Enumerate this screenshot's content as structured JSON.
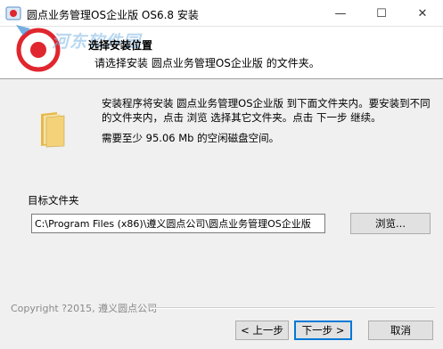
{
  "window": {
    "title": "圆点业务管理OS企业版 OS6.8 安装",
    "minimize_glyph": "—",
    "maximize_glyph": "☐",
    "close_glyph": "✕"
  },
  "header": {
    "watermark": "河东软件园",
    "title": "选择安装位置",
    "subtitle": "请选择安装 圆点业务管理OS企业版 的文件夹。"
  },
  "body": {
    "description": "安装程序将安装 圆点业务管理OS企业版 到下面文件夹内。要安装到不同的文件夹内，点击 浏览 选择其它文件夹。点击 下一步 继续。",
    "space_required": "需要至少 95.06 Mb 的空闲磁盘空间。"
  },
  "destination": {
    "group_label": "目标文件夹",
    "path_value": "C:\\Program Files (x86)\\遵义圆点公司\\圆点业务管理OS企业版",
    "browse_label": "浏览..."
  },
  "footer": {
    "copyright": "Copyright ?2015, 遵义圆点公司",
    "back_label": "< 上一步",
    "next_label": "下一步 >",
    "cancel_label": "取消"
  },
  "colors": {
    "logo_red": "#e0262e",
    "watermark_blue": "#7fb7e4",
    "folder_yellow": "#f3d27a",
    "accent_blue": "#0078d7"
  }
}
